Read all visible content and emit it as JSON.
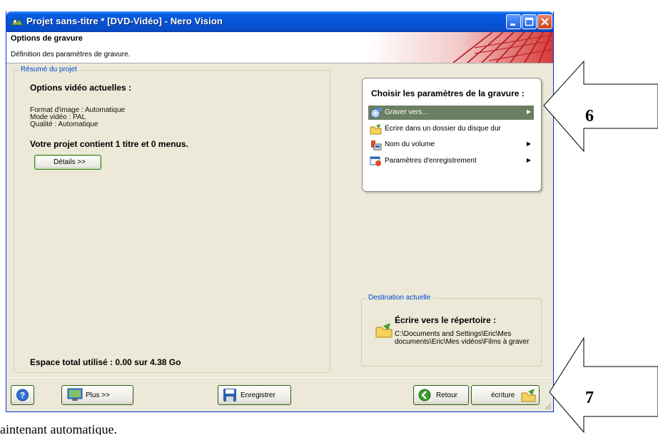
{
  "window": {
    "title": "Projet sans-titre * [DVD-Vidéo] - Nero Vision"
  },
  "header": {
    "title": "Options de gravure",
    "subtitle": "Définition des paramètres de gravure."
  },
  "summary": {
    "legend": "Résumé du projet",
    "video_options_title": "Options vidéo actuelles :",
    "format_line": "Format d'image : Automatique",
    "mode_line": "Mode vidéo : PAL",
    "quality_line": "Qualité : Automatique",
    "contents_line": "Votre projet contient 1 titre et 0 menus.",
    "details_button": "Détails >>",
    "total_space": "Espace total utilisé : 0.00 sur 4.38 Go"
  },
  "burn_settings": {
    "title": "Choisir les paramètres de la gravure :",
    "items": [
      {
        "label": "Graver vers...",
        "icon": "disc-burn-icon",
        "has_submenu": true,
        "selected": true
      },
      {
        "label": "Écrire dans un dossier du disque dur",
        "icon": "folder-write-icon",
        "has_submenu": false,
        "selected": false
      },
      {
        "label": "Nom du volume",
        "icon": "volume-label-icon",
        "has_submenu": true,
        "selected": false
      },
      {
        "label": "Paramètres d'enregistrement",
        "icon": "record-settings-icon",
        "has_submenu": true,
        "selected": false
      }
    ]
  },
  "destination": {
    "legend": "Destination actuelle",
    "title": "Écrire vers le répertoire :",
    "path": "C:\\Documents and Settings\\Eric\\Mes documents\\Eric\\Mes vidéos\\Films à graver"
  },
  "footer": {
    "more_button": "Plus >>",
    "save_button": "Enregistrer",
    "back_button": "Retour",
    "burn_button": "écriture"
  },
  "annotations": {
    "callout_6": "6",
    "callout_7": "7",
    "caption": "aintenant automatique."
  },
  "colors": {
    "titlebar": "#0453d6",
    "selected_item": "#6b7f63",
    "legend_text": "#0046d5"
  }
}
